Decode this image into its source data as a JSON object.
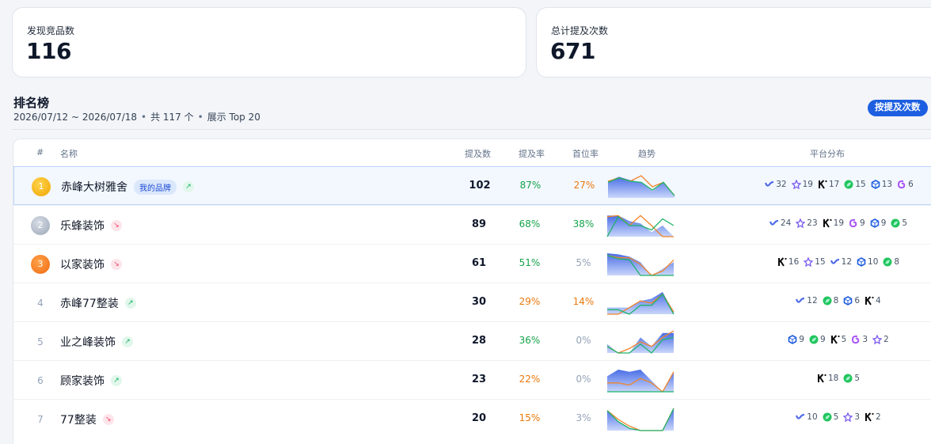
{
  "stats": [
    {
      "label": "发现竞品数",
      "value": "116"
    },
    {
      "label": "总计提及次数",
      "value": "671"
    }
  ],
  "ranking": {
    "title": "排名榜",
    "date_range": "2026/07/12 ~ 2026/07/18",
    "total": "共 117 个",
    "display": "展示 Top 20",
    "sort_button": "按提及次数",
    "columns": [
      "#",
      "名称",
      "提及数",
      "提及率",
      "首位率",
      "趋势",
      "平台分布"
    ],
    "my_brand_badge": "我的品牌",
    "rows": [
      {
        "rank": "1",
        "name": "赤峰大树雅舍",
        "mine": true,
        "trend": "up",
        "mentions": "102",
        "mention_rate": "87%",
        "mention_rate_color": "green",
        "first_rate": "27%",
        "first_rate_color": "orange",
        "spark": [
          [
            0.75,
            0.95,
            0.8,
            0.7,
            0.3,
            0.7,
            0.1
          ],
          [
            0.75,
            0.9,
            0.75,
            1.0,
            0.5,
            0.7,
            0.1
          ],
          [
            0.7,
            0.9,
            0.75,
            0.7,
            0.35,
            0.7,
            0.1
          ]
        ],
        "platforms": [
          {
            "icon": "wave",
            "n": "32"
          },
          {
            "icon": "star",
            "n": "19"
          },
          {
            "icon": "k",
            "n": "17"
          },
          {
            "icon": "leaf",
            "n": "15"
          },
          {
            "icon": "cube",
            "n": "13"
          },
          {
            "icon": "swirl",
            "n": "6"
          }
        ]
      },
      {
        "rank": "2",
        "name": "乐蜂装饰",
        "mine": false,
        "trend": "down",
        "mentions": "89",
        "mention_rate": "68%",
        "mention_rate_color": "green",
        "first_rate": "38%",
        "first_rate_color": "green",
        "spark": [
          [
            0.95,
            0.95,
            0.7,
            0.6,
            0.2,
            0.5,
            0.0
          ],
          [
            0.9,
            0.95,
            0.5,
            0.95,
            0.5,
            0.0,
            0.0
          ],
          [
            0.0,
            0.9,
            0.5,
            0.5,
            0.3,
            0.8,
            0.5
          ]
        ],
        "platforms": [
          {
            "icon": "wave",
            "n": "24"
          },
          {
            "icon": "star",
            "n": "23"
          },
          {
            "icon": "k",
            "n": "19"
          },
          {
            "icon": "swirl",
            "n": "9"
          },
          {
            "icon": "cube",
            "n": "9"
          },
          {
            "icon": "leaf",
            "n": "5"
          }
        ]
      },
      {
        "rank": "3",
        "name": "以家装饰",
        "mine": false,
        "trend": "down",
        "mentions": "61",
        "mention_rate": "51%",
        "mention_rate_color": "green",
        "first_rate": "5%",
        "first_rate_color": "gray",
        "spark": [
          [
            1.0,
            0.95,
            0.85,
            0.6,
            0.0,
            0.3,
            0.6
          ],
          [
            0.9,
            0.8,
            0.8,
            0.5,
            0.0,
            0.2,
            0.7
          ],
          [
            0.9,
            0.75,
            0.7,
            0.0,
            0.0,
            0.0,
            0.0
          ]
        ],
        "platforms": [
          {
            "icon": "k",
            "n": "16"
          },
          {
            "icon": "star",
            "n": "15"
          },
          {
            "icon": "wave",
            "n": "12"
          },
          {
            "icon": "cube",
            "n": "10"
          },
          {
            "icon": "leaf",
            "n": "8"
          }
        ]
      },
      {
        "rank": "4",
        "name": "赤峰77整装",
        "mine": false,
        "trend": "up",
        "mentions": "30",
        "mention_rate": "29%",
        "mention_rate_color": "orange",
        "first_rate": "14%",
        "first_rate_color": "orange",
        "spark": [
          [
            0.3,
            0.3,
            0.3,
            0.6,
            0.7,
            1.0,
            0.1
          ],
          [
            0.0,
            0.0,
            0.3,
            0.6,
            0.5,
            0.9,
            0.1
          ],
          [
            0.2,
            0.2,
            0.0,
            0.4,
            0.4,
            0.9,
            0.0
          ]
        ],
        "platforms": [
          {
            "icon": "wave",
            "n": "12"
          },
          {
            "icon": "leaf",
            "n": "8"
          },
          {
            "icon": "cube",
            "n": "6"
          },
          {
            "icon": "k",
            "n": "4"
          }
        ]
      },
      {
        "rank": "5",
        "name": "业之峰装饰",
        "mine": false,
        "trend": "up",
        "mentions": "28",
        "mention_rate": "36%",
        "mention_rate_color": "green",
        "first_rate": "0%",
        "first_rate_color": "gray",
        "spark": [
          [
            0.4,
            0.0,
            0.0,
            0.7,
            0.3,
            0.9,
            0.9
          ],
          [
            0.3,
            0.0,
            0.2,
            0.5,
            0.3,
            0.7,
            1.0
          ],
          [
            0.3,
            0.0,
            0.0,
            0.4,
            0.0,
            0.6,
            0.7
          ]
        ],
        "platforms": [
          {
            "icon": "cube",
            "n": "9"
          },
          {
            "icon": "leaf",
            "n": "9"
          },
          {
            "icon": "k",
            "n": "5"
          },
          {
            "icon": "swirl",
            "n": "3"
          },
          {
            "icon": "star",
            "n": "2"
          }
        ]
      },
      {
        "rank": "6",
        "name": "顾家装饰",
        "mine": false,
        "trend": "up",
        "mentions": "23",
        "mention_rate": "22%",
        "mention_rate_color": "orange",
        "first_rate": "0%",
        "first_rate_color": "gray",
        "spark": [
          [
            0.7,
            1.0,
            0.9,
            1.0,
            0.5,
            0.0,
            0.9
          ],
          [
            0.4,
            0.4,
            0.3,
            0.6,
            0.4,
            0.0,
            0.9
          ],
          [
            0.0,
            0.0,
            0.0,
            0.0,
            0.0,
            0.0,
            0.0
          ]
        ],
        "platforms": [
          {
            "icon": "k",
            "n": "18"
          },
          {
            "icon": "leaf",
            "n": "5"
          }
        ]
      },
      {
        "rank": "7",
        "name": "77整装",
        "mine": false,
        "trend": "down",
        "mentions": "20",
        "mention_rate": "15%",
        "mention_rate_color": "orange",
        "first_rate": "3%",
        "first_rate_color": "gray",
        "spark": [
          [
            0.9,
            0.4,
            0.1,
            0.0,
            0.0,
            0.0,
            1.0
          ],
          [
            0.9,
            0.5,
            0.2,
            0.0,
            0.0,
            0.0,
            1.0
          ],
          [
            0.9,
            0.4,
            0.1,
            0.0,
            0.0,
            0.0,
            1.0
          ]
        ],
        "platforms": [
          {
            "icon": "wave",
            "n": "10"
          },
          {
            "icon": "leaf",
            "n": "5"
          },
          {
            "icon": "star",
            "n": "3"
          },
          {
            "icon": "k",
            "n": "2"
          }
        ]
      }
    ]
  },
  "colors": {
    "accent": "#1d5fe0",
    "area": "#5b7fe6",
    "line_orange": "#f0832a",
    "line_green": "#1db36a"
  }
}
